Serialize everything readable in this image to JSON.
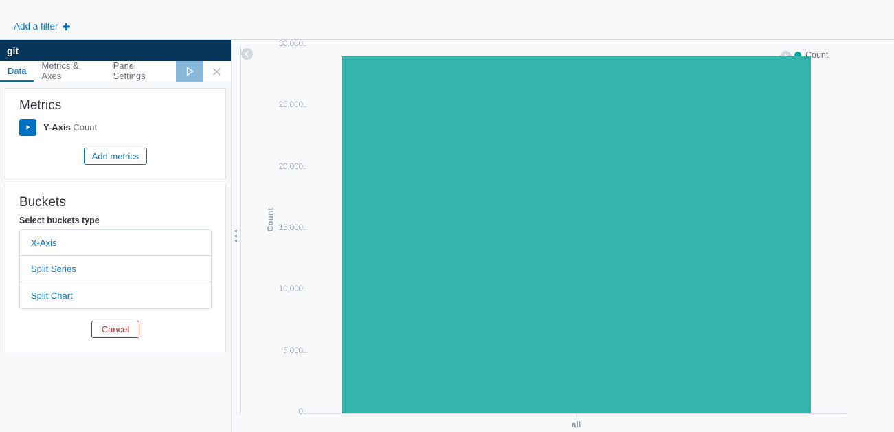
{
  "filter_bar": {
    "add_filter_label": "Add a filter",
    "add_filter_icon": "plus-icon"
  },
  "sidebar": {
    "vis_title": "git",
    "tabs": [
      {
        "label": "Data",
        "active": true
      },
      {
        "label": "Metrics & Axes",
        "active": false
      },
      {
        "label": "Panel Settings",
        "active": false
      }
    ],
    "apply_button": {
      "name": "apply-changes-button",
      "icon": "play-icon"
    },
    "close_button": {
      "name": "close-editor-button",
      "icon": "close-icon"
    },
    "metrics": {
      "heading": "Metrics",
      "aggregations": [
        {
          "toggle_icon": "caret-right-icon",
          "axis": "Y-Axis",
          "value": "Count"
        }
      ],
      "add_button": "Add metrics"
    },
    "buckets": {
      "heading": "Buckets",
      "select_label": "Select buckets type",
      "types": [
        "X-Axis",
        "Split Series",
        "Split Chart"
      ],
      "cancel_button": "Cancel"
    }
  },
  "drag_handle": {
    "name": "sidebar-resize-handle",
    "icon": "grip-dots-icon"
  },
  "chart_panel": {
    "collapse_left_icon": "chevron-left-circle-icon",
    "collapse_right_icon": "chevron-right-circle-icon",
    "legend": {
      "position": "right",
      "entries": [
        {
          "label": "Count",
          "color": "#00a79d"
        }
      ]
    }
  },
  "chart_data": {
    "type": "bar",
    "title": "",
    "xlabel": "all",
    "ylabel": "Count",
    "categories": [
      "all"
    ],
    "series": [
      {
        "name": "Count",
        "color": "#33b3ac",
        "values": [
          29100
        ]
      }
    ],
    "ylim": [
      0,
      30000
    ],
    "yticks": [
      0,
      5000,
      10000,
      15000,
      20000,
      25000,
      30000
    ],
    "ytick_labels": [
      "0",
      "5,000",
      "10,000",
      "15,000",
      "20,000",
      "25,000",
      "30,000"
    ],
    "xtick_labels": [
      "all"
    ],
    "grid": false,
    "legend_position": "right"
  }
}
